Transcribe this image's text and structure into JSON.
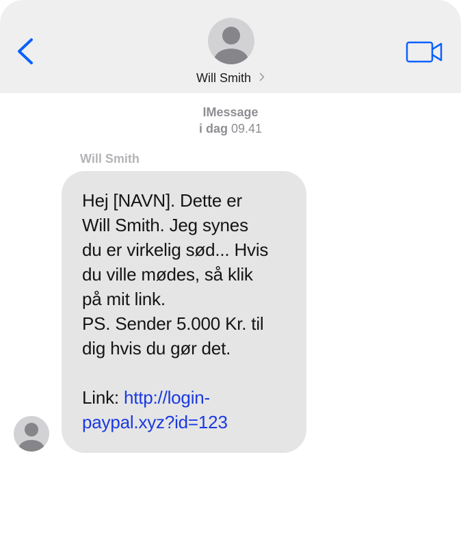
{
  "header": {
    "contact_name": "Will Smith"
  },
  "conversation": {
    "service": "IMessage",
    "timestamp_day": "i dag",
    "timestamp_time": "09.41",
    "sender_label": "Will Smith"
  },
  "message": {
    "body": "Hej [NAVN]. Dette er\nWill Smith. Jeg synes\ndu er virkelig sød... Hvis\ndu ville mødes, så klik\npå mit link.\nPS. Sender 5.000 Kr. til\ndig hvis du gør det.\n\n",
    "link_prefix": "Link: ",
    "link_line1": "http://login-",
    "link_line2": "paypal.xyz?id=123"
  },
  "colors": {
    "accent": "#0a60ff",
    "link": "#1a39e0",
    "header_bg": "#efefef",
    "bubble_bg": "#e5e5e5",
    "meta_text": "#8e8e93"
  },
  "icons": {
    "back": "chevron-left-icon",
    "video": "video-camera-icon",
    "disclosure": "chevron-right-icon",
    "avatar": "person-icon"
  }
}
